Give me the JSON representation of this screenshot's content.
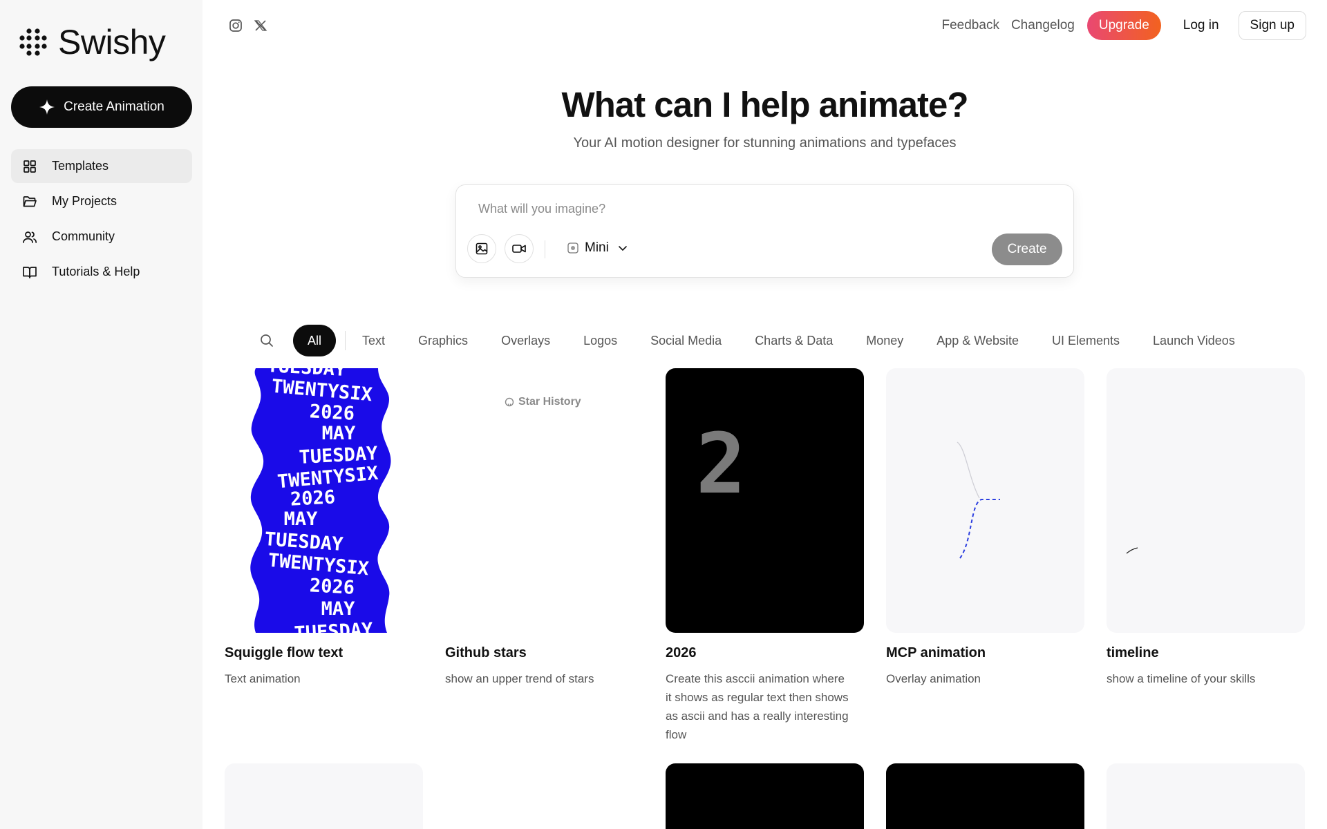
{
  "brand": {
    "name": "Swishy"
  },
  "sidebar": {
    "create_label": "Create Animation",
    "items": [
      {
        "label": "Templates",
        "icon": "grid-icon",
        "active": true
      },
      {
        "label": "My Projects",
        "icon": "folder-icon"
      },
      {
        "label": "Community",
        "icon": "users-icon"
      },
      {
        "label": "Tutorials & Help",
        "icon": "book-icon"
      }
    ]
  },
  "topbar": {
    "social": [
      "instagram-icon",
      "x-icon"
    ],
    "feedback": "Feedback",
    "changelog": "Changelog",
    "upgrade": "Upgrade",
    "login": "Log in",
    "signup": "Sign up"
  },
  "hero": {
    "title": "What can I help animate?",
    "subtitle": "Your AI motion designer for stunning animations and typefaces"
  },
  "prompt": {
    "placeholder": "What will you imagine?",
    "model": "Mini",
    "submit": "Create"
  },
  "categories": [
    "All",
    "Text",
    "Graphics",
    "Overlays",
    "Logos",
    "Social Media",
    "Charts & Data",
    "Money",
    "App & Website",
    "UI Elements",
    "Launch Videos"
  ],
  "cards": [
    {
      "title": "Squiggle flow text",
      "desc": "Text animation",
      "thumb_words": [
        "TUESDAY",
        "TWENTYSIX",
        "2026",
        "MAY",
        "TUESDAY",
        "TWENTYSIX",
        "2026",
        "MAY",
        "TUESDAY",
        "TWENTYSIX",
        "2026",
        "MAY",
        "TUESDAY"
      ]
    },
    {
      "title": "Github stars",
      "desc": "show an upper trend of stars",
      "thumb_label": "Star History"
    },
    {
      "title": "2026",
      "desc": "Create this asccii animation where it shows as regular text then shows as ascii and has a really interesting flow",
      "thumb_digit": "2"
    },
    {
      "title": "MCP animation",
      "desc": "Overlay animation"
    },
    {
      "title": "timeline",
      "desc": "show a timeline of your skills"
    }
  ],
  "colors": {
    "accent_dark": "#0c0c0c",
    "upgrade_gradient_start": "#e94872",
    "upgrade_gradient_end": "#f2621f",
    "squiggle_blue": "#1a0be8"
  }
}
